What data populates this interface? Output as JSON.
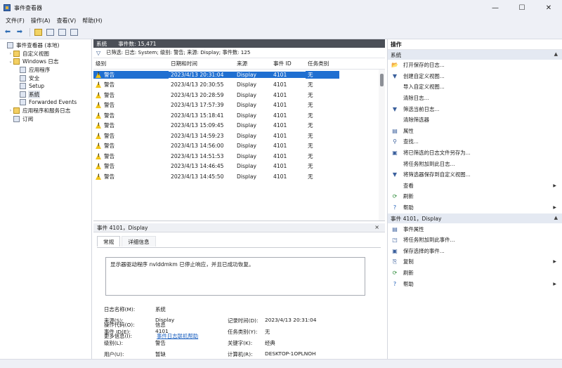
{
  "window": {
    "title": "事件查看器",
    "controls": [
      "—",
      "☐",
      "✕"
    ]
  },
  "menu": [
    "文件(F)",
    "操作(A)",
    "查看(V)",
    "帮助(H)"
  ],
  "tree": [
    {
      "label": "事件查看器 (本地)",
      "indent": 0,
      "twisty": "",
      "icon": "log",
      "selected": false
    },
    {
      "label": "自定义视图",
      "indent": 1,
      "twisty": "›",
      "icon": "folder",
      "selected": false
    },
    {
      "label": "Windows 日志",
      "indent": 1,
      "twisty": "⌄",
      "icon": "folder",
      "selected": false
    },
    {
      "label": "应用程序",
      "indent": 2,
      "twisty": "",
      "icon": "log",
      "selected": false
    },
    {
      "label": "安全",
      "indent": 2,
      "twisty": "",
      "icon": "log",
      "selected": false
    },
    {
      "label": "Setup",
      "indent": 2,
      "twisty": "",
      "icon": "log",
      "selected": false
    },
    {
      "label": "系统",
      "indent": 2,
      "twisty": "",
      "icon": "log",
      "selected": true
    },
    {
      "label": "Forwarded Events",
      "indent": 2,
      "twisty": "",
      "icon": "log",
      "selected": false
    },
    {
      "label": "应用程序和服务日志",
      "indent": 1,
      "twisty": "›",
      "icon": "folder",
      "selected": false
    },
    {
      "label": "订阅",
      "indent": 1,
      "twisty": "",
      "icon": "log",
      "selected": false
    }
  ],
  "center": {
    "log_name": "系统",
    "event_count": "事件数: 15,471",
    "filter_text": "已筛选: 日志: System; 级别: 警告; 来源: Display; 事件数: 125",
    "columns": [
      "级别",
      "日期和时间",
      "来源",
      "事件 ID",
      "任务类别"
    ],
    "rows": [
      [
        "警告",
        "2023/4/13 20:31:04",
        "Display",
        "4101",
        "无"
      ],
      [
        "警告",
        "2023/4/13 20:30:55",
        "Display",
        "4101",
        "无"
      ],
      [
        "警告",
        "2023/4/13 20:28:59",
        "Display",
        "4101",
        "无"
      ],
      [
        "警告",
        "2023/4/13 17:57:39",
        "Display",
        "4101",
        "无"
      ],
      [
        "警告",
        "2023/4/13 15:18:41",
        "Display",
        "4101",
        "无"
      ],
      [
        "警告",
        "2023/4/13 15:09:45",
        "Display",
        "4101",
        "无"
      ],
      [
        "警告",
        "2023/4/13 14:59:23",
        "Display",
        "4101",
        "无"
      ],
      [
        "警告",
        "2023/4/13 14:56:00",
        "Display",
        "4101",
        "无"
      ],
      [
        "警告",
        "2023/4/13 14:51:53",
        "Display",
        "4101",
        "无"
      ],
      [
        "警告",
        "2023/4/13 14:46:45",
        "Display",
        "4101",
        "无"
      ],
      [
        "警告",
        "2023/4/13 14:45:50",
        "Display",
        "4101",
        "无"
      ]
    ],
    "selected_row": 0
  },
  "detail": {
    "header": "事件 4101，Display",
    "close": "×",
    "tabs": [
      "常规",
      "详细信息"
    ],
    "message": "显示器驱动程序 nvlddmkm 已停止响应，并且已成功恢复。",
    "props_left": [
      {
        "label": "日志名称(M):",
        "value": "系统"
      },
      {
        "label": "来源(S):",
        "value": "Display"
      },
      {
        "label": "事件 ID(E):",
        "value": "4101"
      },
      {
        "label": "级别(L):",
        "value": "警告"
      },
      {
        "label": "用户(U):",
        "value": "暂缺"
      },
      {
        "label": "操作代码(O):",
        "value": "信息"
      },
      {
        "label": "更多信息(I):",
        "value": "事件日志联机帮助"
      }
    ],
    "props_right": [
      {
        "label": "记录时间(D):",
        "value": "2023/4/13 20:31:04"
      },
      {
        "label": "任务类别(Y):",
        "value": "无"
      },
      {
        "label": "关键字(K):",
        "value": "经典"
      },
      {
        "label": "计算机(R):",
        "value": "DESKTOP-1OPLNOH"
      }
    ]
  },
  "actions": {
    "title": "操作",
    "section1": "系统",
    "items1": [
      {
        "label": "打开保存的日志...",
        "icon": "📂",
        "sub": false
      },
      {
        "label": "创建自定义视图...",
        "icon": "▼",
        "sub": false
      },
      {
        "label": "导入自定义视图...",
        "icon": "",
        "sub": false
      },
      {
        "label": "清除日志...",
        "icon": "",
        "sub": false
      },
      {
        "label": "筛选当前日志...",
        "icon": "▼",
        "sub": false
      },
      {
        "label": "清除筛选器",
        "icon": "",
        "sub": false
      },
      {
        "label": "属性",
        "icon": "▤",
        "sub": false
      },
      {
        "label": "查找...",
        "icon": "⚲",
        "sub": false
      },
      {
        "label": "将已筛选的日志文件另存为...",
        "icon": "▣",
        "sub": false
      },
      {
        "label": "将任务附加到此日志...",
        "icon": "",
        "sub": false
      },
      {
        "label": "将筛选器保存到自定义视图...",
        "icon": "▼",
        "sub": false
      },
      {
        "label": "查看",
        "icon": "",
        "sub": true
      },
      {
        "label": "刷新",
        "icon": "⟳",
        "sub": false
      },
      {
        "label": "帮助",
        "icon": "?",
        "sub": true
      }
    ],
    "section2": "事件 4101，Display",
    "items2": [
      {
        "label": "事件属性",
        "icon": "▤",
        "sub": false
      },
      {
        "label": "将任务附加到此事件...",
        "icon": "◳",
        "sub": false
      },
      {
        "label": "保存选择的事件...",
        "icon": "▣",
        "sub": false
      },
      {
        "label": "复制",
        "icon": "⎘",
        "sub": true
      },
      {
        "label": "刷新",
        "icon": "⟳",
        "sub": false
      },
      {
        "label": "帮助",
        "icon": "?",
        "sub": true
      }
    ]
  }
}
